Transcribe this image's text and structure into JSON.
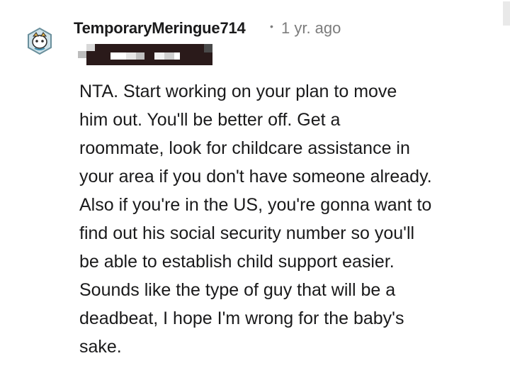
{
  "comment": {
    "author": "TemporaryMeringue714",
    "separator": "•",
    "timestamp": "1 yr. ago",
    "avatar_icon": "snoo-avatar-icon",
    "flair": "redacted",
    "body_lines": [
      "NTA. Start working on your plan to move",
      "him out. You'll be better off. Get a",
      "roommate, look for childcare assistance in",
      "your area if you don't have someone already.",
      "Also if you're in the US, you're gonna want to",
      "find out his social security number so you'll",
      "be able to establish child support easier.",
      "Sounds like the type of guy that will be a",
      "deadbeat, I hope I'm wrong for the baby's",
      "sake."
    ]
  },
  "colors": {
    "text": "#1a1a1b",
    "meta": "#7c7c7c",
    "redaction": "#2a1a1a"
  }
}
